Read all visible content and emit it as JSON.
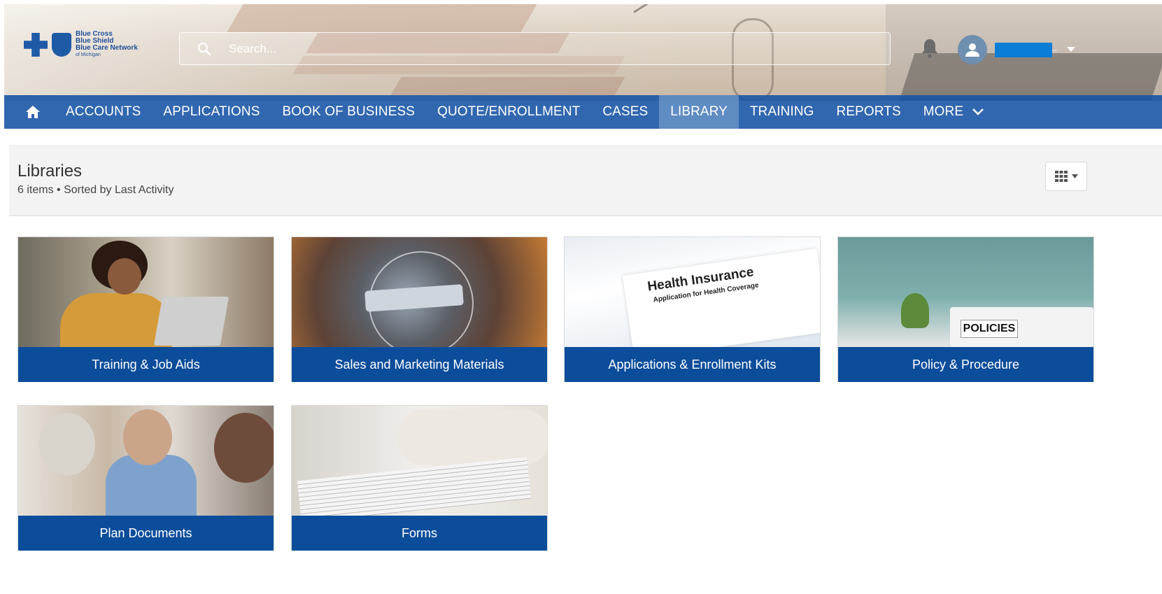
{
  "brand": {
    "name_line1": "Blue Cross",
    "name_line2": "Blue Shield",
    "name_line3": "Blue Care Network",
    "name_line4": "of Michigan"
  },
  "search": {
    "placeholder": "Search..."
  },
  "user": {
    "name": "",
    "ellipsis": ".."
  },
  "nav": {
    "home_icon": "home-icon",
    "items": [
      "ACCOUNTS",
      "APPLICATIONS",
      "BOOK OF BUSINESS",
      "QUOTE/ENROLLMENT",
      "CASES",
      "LIBRARY",
      "TRAINING",
      "REPORTS",
      "MORE"
    ],
    "active": "LIBRARY"
  },
  "list": {
    "title": "Libraries",
    "meta": "6 items • Sorted by Last Activity",
    "view_icon": "grid-view-icon"
  },
  "tiles": [
    {
      "label": "Training & Job Aids"
    },
    {
      "label": "Sales and Marketing Materials"
    },
    {
      "label": "Applications & Enrollment Kits",
      "image_text_title": "Health Insurance",
      "image_text_sub": "Application for Health Coverage"
    },
    {
      "label": "Policy & Procedure",
      "image_text": "POLICIES"
    },
    {
      "label": "Plan Documents"
    },
    {
      "label": "Forms"
    }
  ],
  "colors": {
    "nav_bg": "#1552a4",
    "tile_label_bg": "#0c4d9b",
    "active_nav": "#78a0cd",
    "username_highlight": "#0a7dd6"
  }
}
